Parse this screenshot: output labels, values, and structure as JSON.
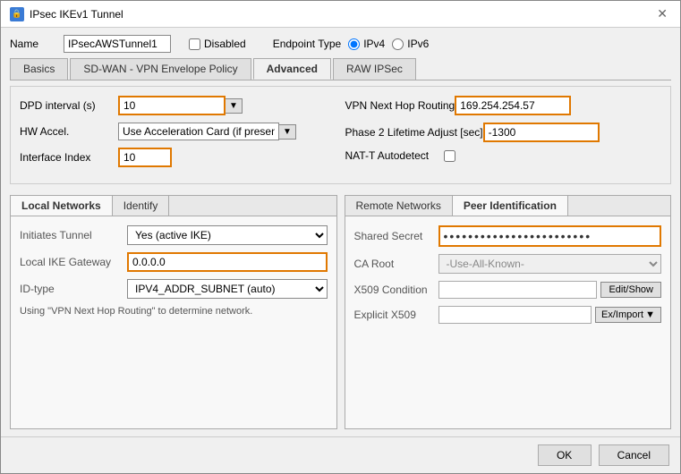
{
  "window": {
    "title": "IPsec IKEv1 Tunnel",
    "icon": "🔒"
  },
  "header": {
    "name_label": "Name",
    "name_value": "IPsecAWSTunnel1",
    "disabled_label": "Disabled",
    "endpoint_type_label": "Endpoint Type",
    "ipv4_label": "IPv4",
    "ipv6_label": "IPv6"
  },
  "tabs": [
    {
      "label": "Basics",
      "active": false
    },
    {
      "label": "SD-WAN - VPN Envelope Policy",
      "active": false
    },
    {
      "label": "Advanced",
      "active": true
    },
    {
      "label": "RAW IPSec",
      "active": false
    }
  ],
  "advanced": {
    "dpd_label": "DPD interval (s)",
    "dpd_value": "10",
    "hw_accel_label": "HW Accel.",
    "hw_accel_value": "Use Acceleration Card (if present)",
    "interface_index_label": "Interface Index",
    "interface_index_value": "10",
    "vpn_next_hop_label": "VPN Next Hop Routing",
    "vpn_next_hop_value": "169.254.254.57",
    "phase2_label": "Phase 2 Lifetime Adjust [sec]",
    "phase2_value": "-1300",
    "nat_t_label": "NAT-T Autodetect"
  },
  "local_networks": {
    "tab_label": "Local Networks",
    "identify_tab_label": "Identify",
    "initiates_tunnel_label": "Initiates Tunnel",
    "initiates_tunnel_value": "Yes (active IKE)",
    "local_ike_label": "Local IKE Gateway",
    "local_ike_value": "0.0.0.0",
    "id_type_label": "ID-type",
    "id_type_value": "IPV4_ADDR_SUBNET (auto)",
    "info_text": "Using \"VPN Next Hop Routing\" to determine network."
  },
  "remote_networks": {
    "tab_label": "Remote Networks",
    "peer_id_tab_label": "Peer Identification",
    "shared_secret_label": "Shared Secret",
    "shared_secret_value": "••••••••••••••••••••••••",
    "ca_root_label": "CA Root",
    "ca_root_value": "-Use-All-Known-",
    "x509_condition_label": "X509 Condition",
    "x509_condition_value": "",
    "explicit_x509_label": "Explicit X509",
    "explicit_x509_value": "",
    "edit_show_btn": "Edit/Show",
    "ex_import_btn": "Ex/Import"
  },
  "footer": {
    "ok_btn": "OK",
    "cancel_btn": "Cancel"
  }
}
